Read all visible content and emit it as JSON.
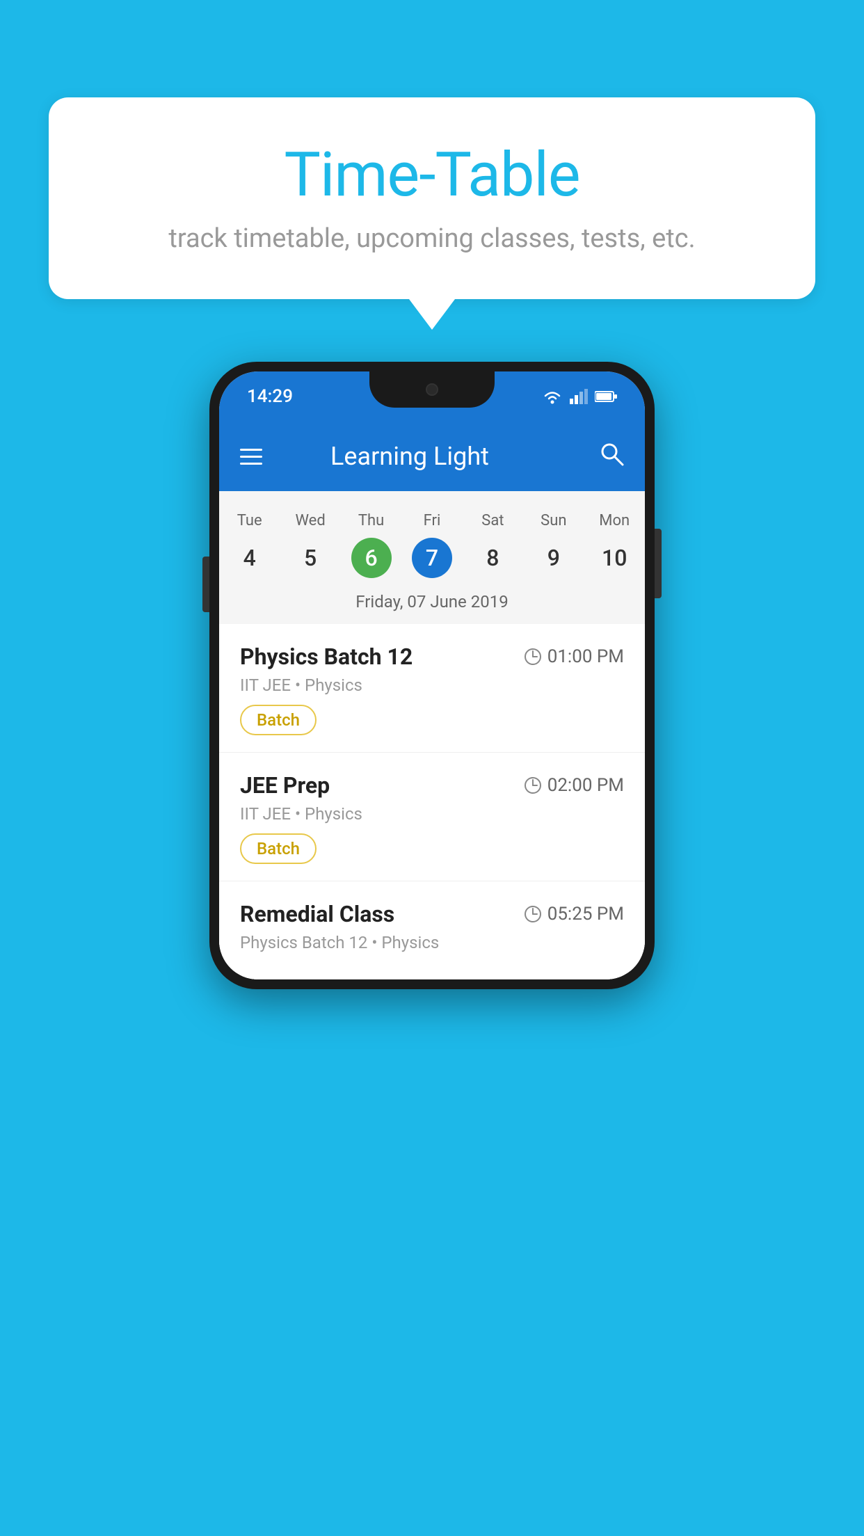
{
  "background_color": "#1DB8E8",
  "speech_bubble": {
    "title": "Time-Table",
    "subtitle": "track timetable, upcoming classes, tests, etc."
  },
  "phone": {
    "status_bar": {
      "time": "14:29"
    },
    "app_bar": {
      "title": "Learning Light"
    },
    "calendar": {
      "days": [
        {
          "name": "Tue",
          "number": "4",
          "state": "normal"
        },
        {
          "name": "Wed",
          "number": "5",
          "state": "normal"
        },
        {
          "name": "Thu",
          "number": "6",
          "state": "today"
        },
        {
          "name": "Fri",
          "number": "7",
          "state": "selected"
        },
        {
          "name": "Sat",
          "number": "8",
          "state": "normal"
        },
        {
          "name": "Sun",
          "number": "9",
          "state": "normal"
        },
        {
          "name": "Mon",
          "number": "10",
          "state": "normal"
        }
      ],
      "selected_date_label": "Friday, 07 June 2019"
    },
    "schedule": [
      {
        "title": "Physics Batch 12",
        "time": "01:00 PM",
        "subtitle": "IIT JEE • Physics",
        "badge": "Batch"
      },
      {
        "title": "JEE Prep",
        "time": "02:00 PM",
        "subtitle": "IIT JEE • Physics",
        "badge": "Batch"
      },
      {
        "title": "Remedial Class",
        "time": "05:25 PM",
        "subtitle": "Physics Batch 12 • Physics",
        "badge": null
      }
    ]
  }
}
